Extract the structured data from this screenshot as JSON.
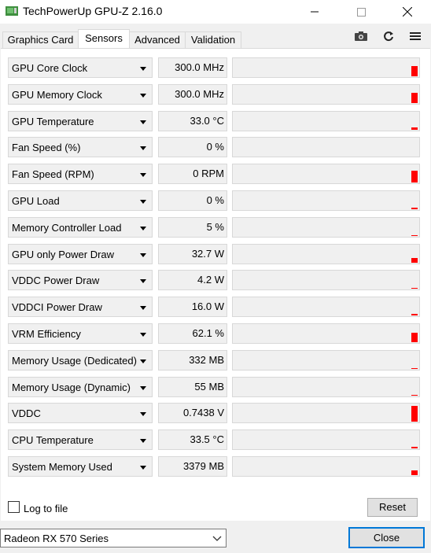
{
  "window": {
    "title": "TechPowerUp GPU-Z 2.16.0"
  },
  "tabs": [
    {
      "label": "Graphics Card",
      "active": false
    },
    {
      "label": "Sensors",
      "active": true
    },
    {
      "label": "Advanced",
      "active": false
    },
    {
      "label": "Validation",
      "active": false
    }
  ],
  "toolbar_icons": [
    "camera-icon",
    "refresh-icon",
    "menu-icon"
  ],
  "sensors": [
    {
      "label": "GPU Core Clock",
      "value": "300.0 MHz",
      "level": 0.6
    },
    {
      "label": "GPU Memory Clock",
      "value": "300.0 MHz",
      "level": 0.6
    },
    {
      "label": "GPU Temperature",
      "value": "33.0 °C",
      "level": 0.15
    },
    {
      "label": "Fan Speed (%)",
      "value": "0 %",
      "level": 0
    },
    {
      "label": "Fan Speed (RPM)",
      "value": "0 RPM",
      "level": 0.7
    },
    {
      "label": "GPU Load",
      "value": "0 %",
      "level": 0.1
    },
    {
      "label": "Memory Controller Load",
      "value": "5 %",
      "level": 0.05
    },
    {
      "label": "GPU only Power Draw",
      "value": "32.7 W",
      "level": 0.25
    },
    {
      "label": "VDDC Power Draw",
      "value": "4.2 W",
      "level": 0.05
    },
    {
      "label": "VDDCI Power Draw",
      "value": "16.0 W",
      "level": 0.1
    },
    {
      "label": "VRM Efficiency",
      "value": "62.1 %",
      "level": 0.55
    },
    {
      "label": "Memory Usage (Dedicated)",
      "value": "332 MB",
      "level": 0.05
    },
    {
      "label": "Memory Usage (Dynamic)",
      "value": "55 MB",
      "level": 0.03
    },
    {
      "label": "VDDC",
      "value": "0.7438 V",
      "level": 0.9
    },
    {
      "label": "CPU Temperature",
      "value": "33.5 °C",
      "level": 0.1
    },
    {
      "label": "System Memory Used",
      "value": "3379 MB",
      "level": 0.25
    }
  ],
  "log_to_file": {
    "label": "Log to file",
    "checked": false
  },
  "reset_label": "Reset",
  "device": {
    "selected": "Radeon RX 570 Series"
  },
  "close_label": "Close",
  "colors": {
    "graph_bar": "#ff0000",
    "focus": "#0078d7"
  }
}
